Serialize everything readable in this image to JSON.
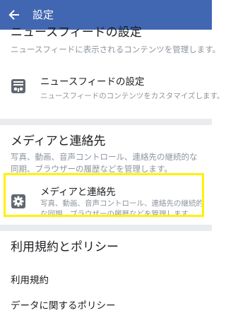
{
  "appbar": {
    "title": "設定",
    "back_icon": "back-arrow-icon"
  },
  "news_feed_section": {
    "heading": "ニュースフィードの設定",
    "description": "ニュースフィードに表示されるコンテンツを管理します。",
    "item": {
      "title": "ニュースフィードの設定",
      "subtitle": "ニュースフィードのコンテンツをカスタマイズします。",
      "icon": "news-feed-settings-icon"
    }
  },
  "media_section": {
    "heading": "メディアと連絡先",
    "description": "写真、動画、音声コントロール、連絡先の継続的な同期、ブラウザーの履歴などを管理します。",
    "item": {
      "title": "メディアと連絡先",
      "subtitle": "写真、動画、音声コントロール、連絡先の継続的な同期、ブラウザーの履歴などを管理します。",
      "icon": "gear-icon"
    },
    "highlight_color": "#fff200"
  },
  "terms_section": {
    "heading": "利用規約とポリシー",
    "items": [
      "利用規約",
      "データに関するポリシー"
    ]
  },
  "colors": {
    "appbar": "#4267b2",
    "divider": "#e9ebee",
    "secondary_text": "#8d949e"
  }
}
